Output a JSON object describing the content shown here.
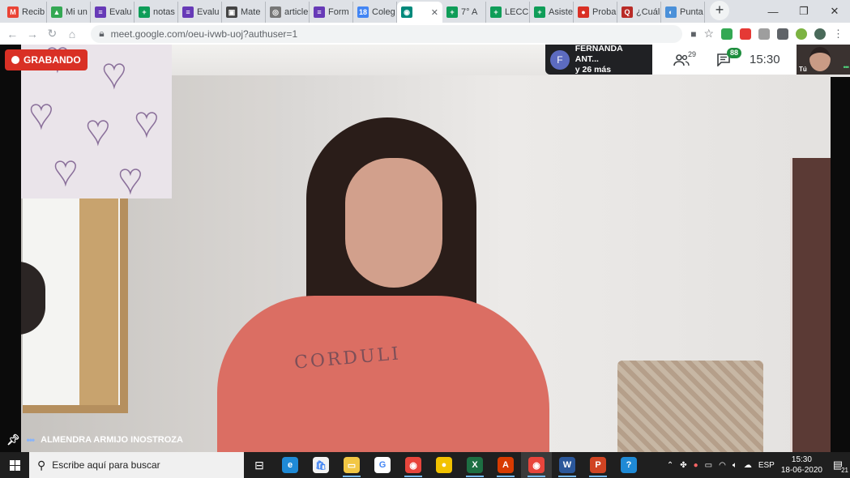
{
  "browser": {
    "tabs": [
      {
        "label": "Recib",
        "icon": "gmail-icon",
        "color": "#ea4335",
        "letter": "M"
      },
      {
        "label": "Mi un",
        "icon": "drive-icon",
        "color": "#34a853",
        "letter": "▲"
      },
      {
        "label": "Evalu",
        "icon": "forms-icon",
        "color": "#673ab7",
        "letter": "≡"
      },
      {
        "label": "notas",
        "icon": "sheets-icon",
        "color": "#0f9d58",
        "letter": "+"
      },
      {
        "label": "Evalu",
        "icon": "forms-icon",
        "color": "#673ab7",
        "letter": "≡"
      },
      {
        "label": "Mate",
        "icon": "classroom-icon",
        "color": "#444444",
        "letter": "▣"
      },
      {
        "label": "article",
        "icon": "web-icon",
        "color": "#777777",
        "letter": "◎"
      },
      {
        "label": "Form",
        "icon": "forms-icon",
        "color": "#673ab7",
        "letter": "≡"
      },
      {
        "label": "Coleg",
        "icon": "calendar-icon",
        "color": "#4285f4",
        "letter": "18"
      },
      {
        "label": "",
        "icon": "meet-icon",
        "color": "#00897b",
        "letter": "◉",
        "active": true
      },
      {
        "label": "7° A",
        "icon": "sheets-icon",
        "color": "#0f9d58",
        "letter": "+"
      },
      {
        "label": "LECC",
        "icon": "sheets-icon",
        "color": "#0f9d58",
        "letter": "+"
      },
      {
        "label": "Asiste",
        "icon": "sheets-icon",
        "color": "#0f9d58",
        "letter": "+"
      },
      {
        "label": "Proba",
        "icon": "web-icon",
        "color": "#d93025",
        "letter": "●"
      },
      {
        "label": "¿Cuál",
        "icon": "quora-icon",
        "color": "#b92b27",
        "letter": "Q"
      },
      {
        "label": "Punta",
        "icon": "web-icon",
        "color": "#4a90d9",
        "letter": "◐"
      }
    ],
    "new_tab_symbol": "+",
    "url": "meet.google.com/oeu-ivwb-uoj?authuser=1"
  },
  "meet": {
    "recording_label": "GRABANDO",
    "presenter_initial": "F",
    "presenter_name": "FERNANDA ANT...",
    "presenter_more": "y 26 más",
    "participants_count": "29",
    "chat_count": "88",
    "time": "15:30",
    "self_label": "Tú",
    "main_participant": "ALMENDRA ARMIJO INOSTROZA",
    "sweater_text": "CORDULI"
  },
  "taskbar": {
    "search_placeholder": "Escribe aquí para buscar",
    "apps": [
      {
        "name": "edge",
        "color": "#1f8ad6",
        "glyph": "e"
      },
      {
        "name": "store",
        "color": "#f3f3f3",
        "glyph": "🛍"
      },
      {
        "name": "explorer",
        "color": "#f2c744",
        "glyph": "▭"
      },
      {
        "name": "google",
        "color": "#ffffff",
        "glyph": "G"
      },
      {
        "name": "chrome",
        "color": "#e8453c",
        "glyph": "◉"
      },
      {
        "name": "norton",
        "color": "#f2c200",
        "glyph": "●"
      },
      {
        "name": "excel",
        "color": "#1d6f42",
        "glyph": "X"
      },
      {
        "name": "acrobat",
        "color": "#d83b01",
        "glyph": "A"
      },
      {
        "name": "chrome-2",
        "color": "#e8453c",
        "glyph": "◉"
      },
      {
        "name": "word",
        "color": "#2b579a",
        "glyph": "W"
      },
      {
        "name": "powerpoint",
        "color": "#d04423",
        "glyph": "P"
      },
      {
        "name": "help",
        "color": "#1f8ad6",
        "glyph": "?"
      }
    ],
    "language": "ESP",
    "time": "15:30",
    "date": "18-06-2020",
    "notifications": "21"
  }
}
